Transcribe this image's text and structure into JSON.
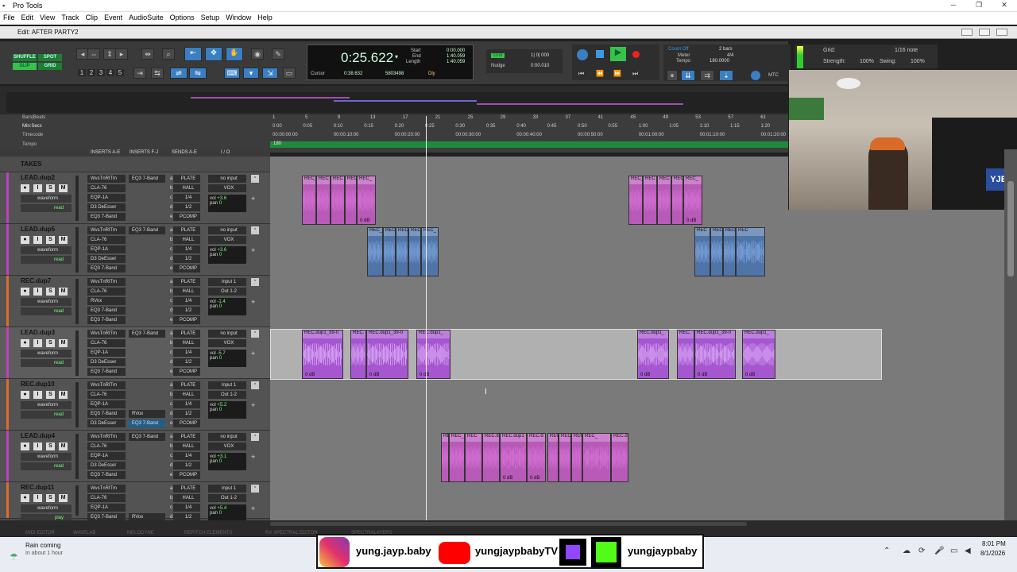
{
  "window": {
    "title": "Pro Tools",
    "edit_title": "Edit: AFTER PARTY2"
  },
  "menu": [
    "File",
    "Edit",
    "View",
    "Track",
    "Clip",
    "Event",
    "AudioSuite",
    "Options",
    "Setup",
    "Window",
    "Help"
  ],
  "modes": [
    "SHUFFLE",
    "SPOT",
    "SLIP",
    "GRID"
  ],
  "zoom_presets": [
    "1",
    "2",
    "3",
    "4",
    "5"
  ],
  "counter": {
    "main": "0:25.622",
    "start_label": "Start",
    "start": "0:00.000",
    "end_label": "End",
    "end": "1:40.059",
    "length_label": "Length",
    "length": "1:40.059",
    "cursor_label": "Cursor",
    "cursor": "0:38.632",
    "sample": "5803498",
    "dly": "Dly"
  },
  "grid_nudge": {
    "grid_label": "Grid",
    "grid_value": "1| 0| 000",
    "nudge_label": "Nudge",
    "nudge_value": "0:00.010"
  },
  "count_off": {
    "label": "Count Off",
    "bars": "2 bars",
    "meter_label": "Meter",
    "meter": "4/4",
    "tempo_label": "Tempo",
    "tempo": "180.0000"
  },
  "grid_right": {
    "grid_label": "Grid:",
    "grid_value": "1/16 note",
    "strength_label": "Strength:",
    "strength": "100%",
    "swing_label": "Swing:",
    "swing": "100%"
  },
  "mtc": "MTC",
  "ruler_labels": [
    "Bars|Beats",
    "Min:Secs",
    "Timecode",
    "Tempo"
  ],
  "bars_ticks": [
    "1",
    "5",
    "9",
    "13",
    "17",
    "21",
    "25",
    "29",
    "33",
    "37",
    "41",
    "45",
    "49",
    "53",
    "57",
    "61"
  ],
  "min_ticks": [
    "0:00",
    "0:05",
    "0:10",
    "0:15",
    "0:20",
    "0:25",
    "0:30",
    "0:35",
    "0:40",
    "0:45",
    "0:50",
    "0:55",
    "1:00",
    "1:05",
    "1:10",
    "1:15",
    "1:20"
  ],
  "tc_ticks": [
    "00:00:00:00",
    "00:00:10:00",
    "00:00:20:00",
    "00:00:30:00",
    "00:00:40:00",
    "00:00:50:00",
    "00:01:00:00",
    "00:01:10:00",
    "00:01:20:00"
  ],
  "tempo_value": "180",
  "mix_headers": [
    "INSERTS A-E",
    "INSERTS F-J",
    "SENDS A-E",
    "I / O"
  ],
  "takes": "TAKES",
  "tracks": [
    {
      "name": "LEAD.dup2",
      "color": "#c040c0",
      "inserts": [
        "WvsTnRlTm",
        "CLA-76",
        "EQP-1A",
        "D3 DeEsser",
        "EQ3 7-Band"
      ],
      "inserts_fj": [
        "EQ3 7-Band"
      ],
      "sends": [
        "PLATE",
        "HALL",
        "1/4",
        "1/2",
        "PCOMP"
      ],
      "send_letters": [
        "a",
        "b",
        "c",
        "d",
        "e"
      ],
      "io_in": "no input",
      "io_out": "VOX",
      "vol": "+3.6",
      "pan": "0",
      "view": "waveform",
      "mode": "read"
    },
    {
      "name": "LEAD.dup5",
      "color": "#c040c0",
      "inserts": [
        "WvsTnRlTm",
        "CLA-76",
        "EQP-1A",
        "D3 DeEsser",
        "EQ3 7-Band"
      ],
      "inserts_fj": [
        "EQ3 7-Band"
      ],
      "sends": [
        "PLATE",
        "HALL",
        "1/4",
        "1/2",
        "PCOMP"
      ],
      "send_letters": [
        "a",
        "b",
        "c",
        "d",
        "e"
      ],
      "io_in": "no input",
      "io_out": "VOX",
      "vol": "+3.6",
      "pan": "0",
      "view": "waveform",
      "mode": "read"
    },
    {
      "name": "REC.dup7",
      "color": "#e06a2a",
      "inserts": [
        "WvsTnRlTm",
        "CLA-76",
        "RVox",
        "EQ3 7-Band",
        "EQ3 7-Band"
      ],
      "inserts_fj": [],
      "sends": [
        "PLATE",
        "HALL",
        "1/4",
        "1/2",
        "PCOMP"
      ],
      "send_letters": [
        "a",
        "b",
        "c",
        "d",
        "e"
      ],
      "io_in": "Input 1",
      "io_out": "Out 1-2",
      "vol": "-1.4",
      "pan": "0",
      "view": "waveform",
      "mode": "read"
    },
    {
      "name": "LEAD.dup3",
      "color": "#c040c0",
      "inserts": [
        "WvsTnRlTm",
        "CLA-76",
        "EQP-1A",
        "D3 DeEsser",
        "EQ3 7-Band"
      ],
      "inserts_fj": [
        "EQ3 7-Band"
      ],
      "sends": [
        "PLATE",
        "HALL",
        "1/4",
        "1/2",
        "PCOMP"
      ],
      "send_letters": [
        "a",
        "b",
        "c",
        "d",
        "e"
      ],
      "io_in": "no input",
      "io_out": "VOX",
      "vol": "-5.7",
      "pan": "0",
      "view": "waveform",
      "mode": "read"
    },
    {
      "name": "REC.dup10",
      "color": "#e06a2a",
      "inserts": [
        "WvsTnRlTm",
        "CLA-76",
        "EQP-1A",
        "EQ3 7-Band",
        "D3 DeEsser"
      ],
      "inserts_fj": [
        "RVox",
        "EQ3 7-Band"
      ],
      "sends": [
        "PLATE",
        "HALL",
        "1/4",
        "1/2",
        "PCOMP"
      ],
      "send_letters": [
        "a",
        "b",
        "c",
        "d",
        "e"
      ],
      "io_in": "Input 1",
      "io_out": "Out 1-2",
      "vol": "+5.2",
      "pan": "0",
      "view": "waveform",
      "mode": "read"
    },
    {
      "name": "LEAD.dup4",
      "color": "#c040c0",
      "inserts": [
        "WvsTnRlTm",
        "CLA-76",
        "EQP-1A",
        "D3 DeEsser",
        "EQ3 7-Band"
      ],
      "inserts_fj": [
        "EQ3 7-Band"
      ],
      "sends": [
        "PLATE",
        "HALL",
        "1/4",
        "1/2",
        "PCOMP"
      ],
      "send_letters": [
        "a",
        "b",
        "c",
        "d",
        "e"
      ],
      "io_in": "no input",
      "io_out": "VOX",
      "vol": "+3.1",
      "pan": "0",
      "view": "waveform",
      "mode": "read"
    },
    {
      "name": "REC.dup11",
      "color": "#e06a2a",
      "inserts": [
        "WvsTnRlTm",
        "CLA-76",
        "EQP-1A",
        "EQ3 7-Band"
      ],
      "inserts_fj": [
        "RVox"
      ],
      "sends": [
        "PLATE",
        "HALL",
        "1/4",
        "1/2"
      ],
      "send_letters": [
        "a",
        "b",
        "c",
        "d"
      ],
      "io_in": "Input 1",
      "io_out": "Out 1-2",
      "vol": "+5.4",
      "pan": "0",
      "view": "waveform",
      "mode": "play"
    }
  ],
  "clips": {
    "track0": [
      {
        "label": "REC_",
        "db": ""
      },
      {
        "label": "REC",
        "db": ""
      },
      {
        "label": "REC",
        "db": ""
      },
      {
        "label": "REC",
        "db": ""
      },
      {
        "label": "REC_",
        "db": "0 dB"
      },
      {
        "label": "REC_",
        "db": ""
      },
      {
        "label": "REC",
        "db": ""
      },
      {
        "label": "REC",
        "db": ""
      },
      {
        "label": "REC",
        "db": ""
      },
      {
        "label": "REC_",
        "db": "0 dB"
      }
    ],
    "track1": [
      {
        "label": "REC_",
        "db": ""
      },
      {
        "label": "REC",
        "db": ""
      },
      {
        "label": "REC",
        "db": ""
      },
      {
        "label": "REC",
        "db": ""
      },
      {
        "label": "REC_",
        "db": ""
      },
      {
        "label": "REC",
        "db": ""
      },
      {
        "label": "REC",
        "db": ""
      },
      {
        "label": "REC",
        "db": ""
      },
      {
        "label": "REC",
        "db": ""
      }
    ],
    "track3": [
      {
        "label": "REC.dup1_39-0",
        "db": "0 dB"
      },
      {
        "label": "REC.",
        "db": ""
      },
      {
        "label": "REC.dup1_39-0",
        "db": "0 dB"
      },
      {
        "label": "REC.dup1_",
        "db": "0 dB"
      },
      {
        "label": "REC.dup1_",
        "db": "0 dB"
      },
      {
        "label": "REC.",
        "db": ""
      },
      {
        "label": "REC.dup1_39-0",
        "db": "0 dB"
      },
      {
        "label": "REC.dup1_",
        "db": "0 dB"
      }
    ],
    "track5": [
      {
        "label": "RE",
        "db": ""
      },
      {
        "label": "REC_",
        "db": ""
      },
      {
        "label": "REC",
        "db": ""
      },
      {
        "label": "REC.d",
        "db": ""
      },
      {
        "label": "REC.dup1",
        "db": "0 dB"
      },
      {
        "label": "REC.d",
        "db": "0 dB"
      },
      {
        "label": "REC",
        "db": ""
      },
      {
        "label": "REC",
        "db": ""
      },
      {
        "label": "REC",
        "db": ""
      },
      {
        "label": "REC_",
        "db": ""
      },
      {
        "label": "REC.d",
        "db": ""
      }
    ]
  },
  "bottom_tabs": [
    "MIDI EDITOR",
    "WAVELAB",
    "MELODYNE",
    "REPITCH ELEMENTS",
    "RX SPECTRAL EDITOR",
    "SPECTRALAYERS"
  ],
  "social": {
    "instagram": "yung.jayp.baby",
    "youtube": "yungjaypbabyTV",
    "kick": "yungjaypbaby"
  },
  "weather": {
    "title": "Rain coming",
    "sub": "In about 1 hour"
  },
  "clock": {
    "time": "8:01 PM",
    "date": "8/1/2026"
  },
  "cam_badge": "YJB"
}
